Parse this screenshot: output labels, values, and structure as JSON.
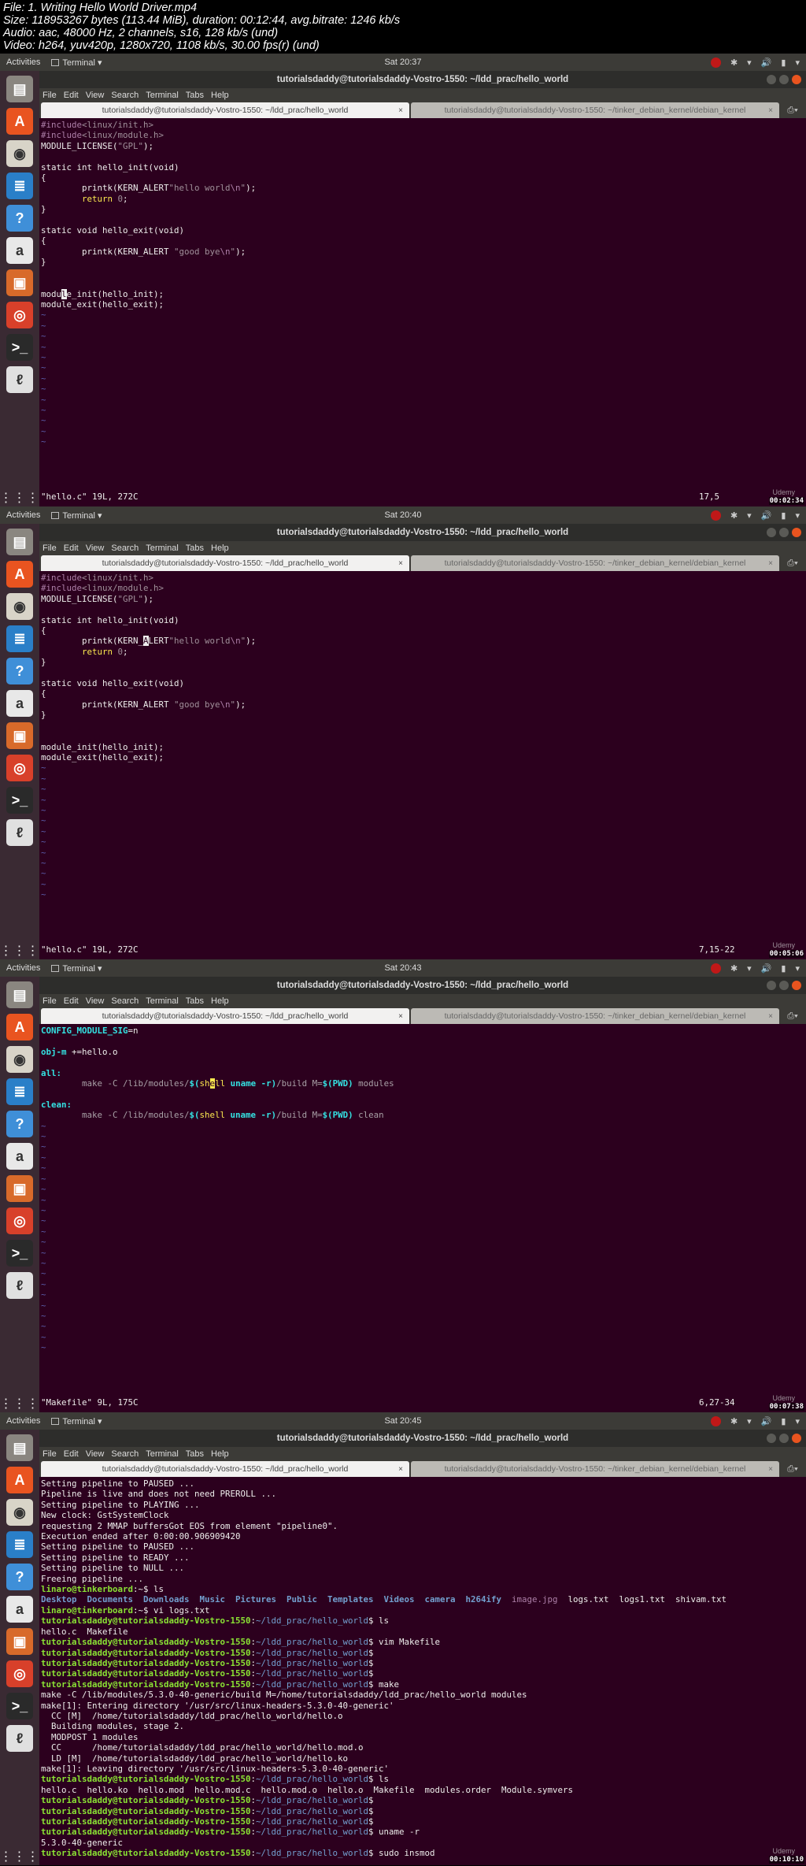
{
  "info": [
    "File: 1. Writing Hello World Driver.mp4",
    "Size: 118953267 bytes (113.44 MiB), duration: 00:12:44, avg.bitrate: 1246 kb/s",
    "Audio: aac, 48000 Hz, 2 channels, s16, 128 kb/s (und)",
    "Video: h264, yuv420p, 1280x720, 1108 kb/s, 30.00 fps(r) (und)"
  ],
  "common": {
    "activities": "Activities",
    "app": "Terminal ▾",
    "tray": [
      "✱",
      "▾",
      "🔊",
      "▮",
      "▾"
    ],
    "window_title": "tutorialsdaddy@tutorialsdaddy-Vostro-1550: ~/ldd_prac/hello_world",
    "menu": [
      "File",
      "Edit",
      "View",
      "Search",
      "Terminal",
      "Tabs",
      "Help"
    ],
    "tab1": "tutorialsdaddy@tutorialsdaddy-Vostro-1550: ~/ldd_prac/hello_world",
    "tab2": "tutorialsdaddy@tutorialsdaddy-Vostro-1550: ~/tinker_debian_kernel/debian_kernel",
    "tab_close": "×",
    "tilde": "~",
    "watermark": "Udemy",
    "dock": [
      {
        "name": "files",
        "g": "▤",
        "c": "#8a8680"
      },
      {
        "name": "software",
        "g": "A",
        "c": "#e95420"
      },
      {
        "name": "rhythmbox",
        "g": "◉",
        "c": "#d8d4c8"
      },
      {
        "name": "writer",
        "g": "≣",
        "c": "#2a7fc8"
      },
      {
        "name": "help",
        "g": "?",
        "c": "#3f8fd8"
      },
      {
        "name": "amazon",
        "g": "a",
        "c": "#e8e8e8"
      },
      {
        "name": "impress",
        "g": "▣",
        "c": "#d86a2a"
      },
      {
        "name": "chrome",
        "g": "◎",
        "c": "#d8402a"
      },
      {
        "name": "terminal",
        "g": ">_",
        "c": "#2a2a2a"
      },
      {
        "name": "app-red",
        "g": "ℓ",
        "c": "#e0e0e0"
      }
    ],
    "apps_grid": "⋮⋮⋮"
  },
  "panels": [
    {
      "clock": "Sat 20:37",
      "status": "\"hello.c\" 19L, 272C",
      "pos": "17,5",
      "timestamp": "00:02:34",
      "tildes": 13,
      "lines": [
        [
          [
            "pp",
            "#include"
          ],
          [
            "str",
            "<linux/init.h>"
          ]
        ],
        [
          [
            "pp",
            "#include"
          ],
          [
            "str",
            "<linux/module.h>"
          ]
        ],
        [
          [
            "",
            "MODULE_LICENSE("
          ],
          [
            "str",
            "\"GPL\""
          ],
          [
            "",
            ");"
          ]
        ],
        [],
        [
          [
            "",
            "static int hello_init(void)"
          ]
        ],
        [
          [
            "",
            "{"
          ]
        ],
        [
          [
            "",
            "        printk(KERN_ALERT"
          ],
          [
            "str",
            "\"hello world"
          ],
          [
            "pp",
            "\\n"
          ],
          [
            "str",
            "\""
          ],
          [
            "",
            ");"
          ]
        ],
        [
          [
            "kw",
            "        return "
          ],
          [
            "str",
            "0"
          ],
          [
            "",
            ";"
          ]
        ],
        [
          [
            "",
            "}"
          ]
        ],
        [],
        [
          [
            "",
            "static void hello_exit(void)"
          ]
        ],
        [
          [
            "",
            "{"
          ]
        ],
        [
          [
            "",
            "        printk(KERN_ALERT "
          ],
          [
            "str",
            "\"good bye"
          ],
          [
            "pp",
            "\\n"
          ],
          [
            "str",
            "\""
          ],
          [
            "",
            ");"
          ]
        ],
        [
          [
            "",
            "}"
          ]
        ],
        [],
        [],
        [
          [
            "",
            "modu"
          ],
          [
            "curw",
            "l"
          ],
          [
            "",
            "e_init(hello_init);"
          ]
        ],
        [
          [
            "",
            "module_exit(hello_exit);"
          ]
        ]
      ]
    },
    {
      "clock": "Sat 20:40",
      "status": "\"hello.c\" 19L, 272C",
      "pos": "7,15-22",
      "timestamp": "00:05:06",
      "tildes": 13,
      "lines": [
        [
          [
            "pp",
            "#include"
          ],
          [
            "str",
            "<linux/init.h>"
          ]
        ],
        [
          [
            "pp",
            "#include"
          ],
          [
            "str",
            "<linux/module.h>"
          ]
        ],
        [
          [
            "",
            "MODULE_LICENSE("
          ],
          [
            "str",
            "\"GPL\""
          ],
          [
            "",
            ");"
          ]
        ],
        [],
        [
          [
            "",
            "static int hello_init(void)"
          ]
        ],
        [
          [
            "",
            "{"
          ]
        ],
        [
          [
            "",
            "        printk(KERN_"
          ],
          [
            "curw",
            "A"
          ],
          [
            "",
            "LERT"
          ],
          [
            "str",
            "\"hello world"
          ],
          [
            "pp",
            "\\n"
          ],
          [
            "str",
            "\""
          ],
          [
            "",
            ");"
          ]
        ],
        [
          [
            "kw",
            "        return "
          ],
          [
            "str",
            "0"
          ],
          [
            "",
            ";"
          ]
        ],
        [
          [
            "",
            "}"
          ]
        ],
        [],
        [
          [
            "",
            "static void hello_exit(void)"
          ]
        ],
        [
          [
            "",
            "{"
          ]
        ],
        [
          [
            "",
            "        printk(KERN_ALERT "
          ],
          [
            "str",
            "\"good bye"
          ],
          [
            "pp",
            "\\n"
          ],
          [
            "str",
            "\""
          ],
          [
            "",
            ");"
          ]
        ],
        [
          [
            "",
            "}"
          ]
        ],
        [],
        [],
        [
          [
            "",
            "module_init(hello_init);"
          ]
        ],
        [
          [
            "",
            "module_exit(hello_exit);"
          ]
        ]
      ]
    },
    {
      "clock": "Sat 20:43",
      "status": "\"Makefile\" 9L, 175C",
      "pos": "6,27-34",
      "timestamp": "00:07:38",
      "tildes": 22,
      "lines": [
        [
          [
            "cy",
            "CONFIG_MODULE_SIG"
          ],
          [
            "",
            "=n"
          ]
        ],
        [],
        [
          [
            "cy",
            "obj-m"
          ],
          [
            "",
            " +=hello.o"
          ]
        ],
        [],
        [
          [
            "cy",
            "all:"
          ]
        ],
        [
          [
            "dim",
            "        make -C /lib/modules/"
          ],
          [
            "cy",
            "$("
          ],
          [
            "kw",
            "sh"
          ],
          [
            "cur",
            "e"
          ],
          [
            "kw",
            "ll"
          ],
          [
            "cy",
            " uname -r)"
          ],
          [
            "dim",
            "/build M="
          ],
          [
            "cy",
            "$(PWD)"
          ],
          [
            "dim",
            " modules"
          ]
        ],
        [],
        [
          [
            "cy",
            "clean:"
          ]
        ],
        [
          [
            "dim",
            "        make -C /lib/modules/"
          ],
          [
            "cy",
            "$("
          ],
          [
            "kw",
            "shell"
          ],
          [
            "cy",
            " uname -r)"
          ],
          [
            "dim",
            "/build M="
          ],
          [
            "cy",
            "$(PWD)"
          ],
          [
            "dim",
            " clean"
          ]
        ]
      ]
    },
    {
      "clock": "Sat 20:45",
      "status": "",
      "pos": "",
      "timestamp": "00:10:10",
      "tildes": 0,
      "lines": [
        [
          [
            "",
            "Setting pipeline to PAUSED ..."
          ]
        ],
        [
          [
            "",
            "Pipeline is live and does not need PREROLL ..."
          ]
        ],
        [
          [
            "",
            "Setting pipeline to PLAYING ..."
          ]
        ],
        [
          [
            "",
            "New clock: GstSystemClock"
          ]
        ],
        [
          [
            "",
            "requesting 2 MMAP buffersGot EOS from element \"pipeline0\"."
          ]
        ],
        [
          [
            "",
            "Execution ended after 0:00:00.906909420"
          ]
        ],
        [
          [
            "",
            "Setting pipeline to PAUSED ..."
          ]
        ],
        [
          [
            "",
            "Setting pipeline to READY ..."
          ]
        ],
        [
          [
            "",
            "Setting pipeline to NULL ..."
          ]
        ],
        [
          [
            "",
            "Freeing pipeline ..."
          ]
        ],
        [
          [
            "g",
            "linaro@tinkerboard"
          ],
          [
            "",
            ":~$ ls"
          ]
        ],
        [
          [
            "bl",
            "Desktop  Documents  Downloads  Music  Pictures  Public  Templates  Videos  camera  h264ify  "
          ],
          [
            "pk",
            "image.jpg"
          ],
          [
            "",
            "  logs.txt  logs1.txt  shivam.txt"
          ]
        ],
        [
          [
            "g",
            "linaro@tinkerboard"
          ],
          [
            "",
            ":~$ vi logs.txt"
          ]
        ],
        [
          [
            "g",
            "tutorialsdaddy@tutorialsdaddy-Vostro-1550"
          ],
          [
            "",
            ":"
          ],
          [
            "b",
            "~/ldd_prac/hello_world"
          ],
          [
            "",
            "$ ls"
          ]
        ],
        [
          [
            "",
            "hello.c  Makefile"
          ]
        ],
        [
          [
            "g",
            "tutorialsdaddy@tutorialsdaddy-Vostro-1550"
          ],
          [
            "",
            ":"
          ],
          [
            "b",
            "~/ldd_prac/hello_world"
          ],
          [
            "",
            "$ vim Makefile"
          ]
        ],
        [
          [
            "g",
            "tutorialsdaddy@tutorialsdaddy-Vostro-1550"
          ],
          [
            "",
            ":"
          ],
          [
            "b",
            "~/ldd_prac/hello_world"
          ],
          [
            "",
            "$"
          ]
        ],
        [
          [
            "g",
            "tutorialsdaddy@tutorialsdaddy-Vostro-1550"
          ],
          [
            "",
            ":"
          ],
          [
            "b",
            "~/ldd_prac/hello_world"
          ],
          [
            "",
            "$"
          ]
        ],
        [
          [
            "g",
            "tutorialsdaddy@tutorialsdaddy-Vostro-1550"
          ],
          [
            "",
            ":"
          ],
          [
            "b",
            "~/ldd_prac/hello_world"
          ],
          [
            "",
            "$"
          ]
        ],
        [
          [
            "g",
            "tutorialsdaddy@tutorialsdaddy-Vostro-1550"
          ],
          [
            "",
            ":"
          ],
          [
            "b",
            "~/ldd_prac/hello_world"
          ],
          [
            "",
            "$ make"
          ]
        ],
        [
          [
            "",
            "make -C /lib/modules/5.3.0-40-generic/build M=/home/tutorialsdaddy/ldd_prac/hello_world modules"
          ]
        ],
        [
          [
            "",
            "make[1]: Entering directory '/usr/src/linux-headers-5.3.0-40-generic'"
          ]
        ],
        [
          [
            "",
            "  CC [M]  /home/tutorialsdaddy/ldd_prac/hello_world/hello.o"
          ]
        ],
        [
          [
            "",
            "  Building modules, stage 2."
          ]
        ],
        [
          [
            "",
            "  MODPOST 1 modules"
          ]
        ],
        [
          [
            "",
            "  CC      /home/tutorialsdaddy/ldd_prac/hello_world/hello.mod.o"
          ]
        ],
        [
          [
            "",
            "  LD [M]  /home/tutorialsdaddy/ldd_prac/hello_world/hello.ko"
          ]
        ],
        [
          [
            "",
            "make[1]: Leaving directory '/usr/src/linux-headers-5.3.0-40-generic'"
          ]
        ],
        [
          [
            "g",
            "tutorialsdaddy@tutorialsdaddy-Vostro-1550"
          ],
          [
            "",
            ":"
          ],
          [
            "b",
            "~/ldd_prac/hello_world"
          ],
          [
            "",
            "$ ls"
          ]
        ],
        [
          [
            "",
            "hello.c  hello.ko  hello.mod  hello.mod.c  hello.mod.o  hello.o  Makefile  modules.order  Module.symvers"
          ]
        ],
        [
          [
            "g",
            "tutorialsdaddy@tutorialsdaddy-Vostro-1550"
          ],
          [
            "",
            ":"
          ],
          [
            "b",
            "~/ldd_prac/hello_world"
          ],
          [
            "",
            "$"
          ]
        ],
        [
          [
            "g",
            "tutorialsdaddy@tutorialsdaddy-Vostro-1550"
          ],
          [
            "",
            ":"
          ],
          [
            "b",
            "~/ldd_prac/hello_world"
          ],
          [
            "",
            "$"
          ]
        ],
        [
          [
            "g",
            "tutorialsdaddy@tutorialsdaddy-Vostro-1550"
          ],
          [
            "",
            ":"
          ],
          [
            "b",
            "~/ldd_prac/hello_world"
          ],
          [
            "",
            "$"
          ]
        ],
        [
          [
            "g",
            "tutorialsdaddy@tutorialsdaddy-Vostro-1550"
          ],
          [
            "",
            ":"
          ],
          [
            "b",
            "~/ldd_prac/hello_world"
          ],
          [
            "",
            "$ uname -r"
          ]
        ],
        [
          [
            "",
            "5.3.0-40-generic"
          ]
        ],
        [
          [
            "g",
            "tutorialsdaddy@tutorialsdaddy-Vostro-1550"
          ],
          [
            "",
            ":"
          ],
          [
            "b",
            "~/ldd_prac/hello_world"
          ],
          [
            "",
            "$ sudo insmod"
          ]
        ]
      ]
    }
  ]
}
